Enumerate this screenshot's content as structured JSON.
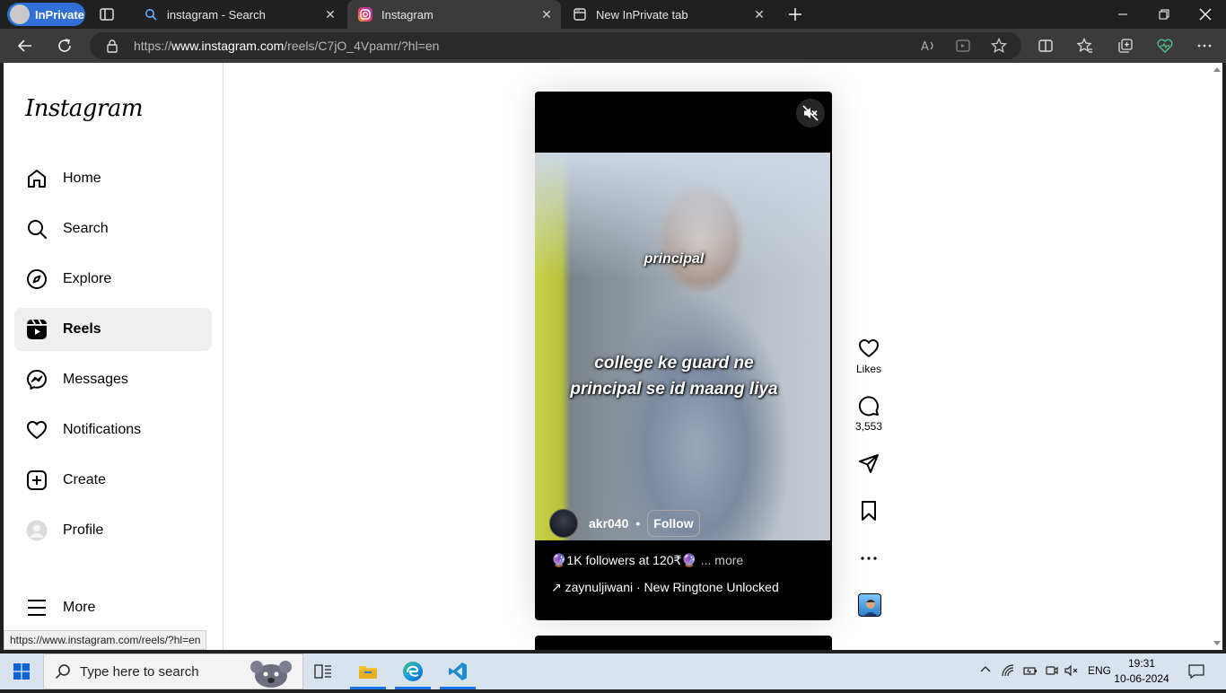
{
  "browser": {
    "inprivate_label": "InPrivate",
    "tabs": [
      {
        "title": "instagram - Search",
        "icon": "search-icon"
      },
      {
        "title": "Instagram",
        "icon": "instagram-icon",
        "active": true
      },
      {
        "title": "New InPrivate tab",
        "icon": "newtab-icon"
      }
    ],
    "url_prefix": "https://",
    "url_domain": "www.instagram.com",
    "url_path": "/reels/C7jO_4Vpamr/?hl=en"
  },
  "instagram": {
    "logo": "Instagram",
    "nav": [
      {
        "label": "Home",
        "icon": "home-icon"
      },
      {
        "label": "Search",
        "icon": "search-icon"
      },
      {
        "label": "Explore",
        "icon": "compass-icon"
      },
      {
        "label": "Reels",
        "icon": "reels-icon",
        "active": true
      },
      {
        "label": "Messages",
        "icon": "messenger-icon"
      },
      {
        "label": "Notifications",
        "icon": "heart-icon"
      },
      {
        "label": "Create",
        "icon": "plus-square-icon"
      },
      {
        "label": "Profile",
        "icon": "profile-avatar"
      },
      {
        "label": "More",
        "icon": "hamburger-icon"
      }
    ],
    "status_url": "https://www.instagram.com/reels/?hl=en",
    "reel": {
      "caption_top": "principal",
      "caption_line1": "college ke guard ne",
      "caption_line2": "principal se id maang liya",
      "username": "akr040",
      "separator": "•",
      "follow_label": "Follow",
      "description": "🔮1K followers at 120₹🔮",
      "more_label": "... more",
      "audio": "↗ zaynuljiwani · New Ringtone Unlocked"
    },
    "actions": {
      "likes_label": "Likes",
      "comments_count": "3,553"
    }
  },
  "taskbar": {
    "search_placeholder": "Type here to search",
    "language": "ENG",
    "time": "19:31",
    "date": "10-06-2024"
  }
}
